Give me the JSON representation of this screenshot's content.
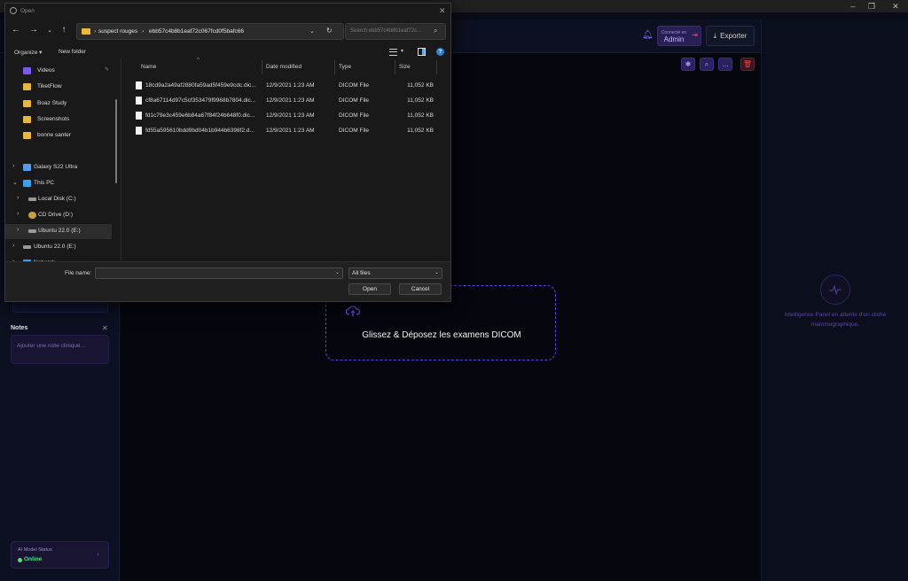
{
  "dialog": {
    "title": "Open",
    "address": {
      "crumbs": [
        "suspect rouges",
        "ebb57c4b8b1eaf72c067fcd0f5bafc66"
      ]
    },
    "search_placeholder": "Search ebb57c4b8b1eaf72c...",
    "toolbar": {
      "organize": "Organize ▾",
      "new_folder": "New folder"
    },
    "sidebar": [
      {
        "label": "Videos",
        "icon": "videos-icon",
        "pinned": true
      },
      {
        "label": "TiketFlow",
        "icon": "folder-icon"
      },
      {
        "label": "Boaz Study",
        "icon": "folder-icon"
      },
      {
        "label": "Screenshots",
        "icon": "folder-icon"
      },
      {
        "label": "bonne santer",
        "icon": "folder-icon"
      },
      {
        "label": "Galaxy S22 Ultra",
        "icon": "phone-icon"
      },
      {
        "label": "This PC",
        "icon": "computer-icon"
      },
      {
        "label": "Local Disk (C:)",
        "icon": "drive-icon"
      },
      {
        "label": "CD Drive (D:)",
        "icon": "cd-drive-icon"
      },
      {
        "label": "Ubuntu 22.0 (E:)",
        "icon": "drive-icon",
        "selected": true
      },
      {
        "label": "Ubuntu 22.0 (E:)",
        "icon": "drive-icon"
      },
      {
        "label": "Network",
        "icon": "network-icon"
      }
    ],
    "columns": {
      "name": "Name",
      "date": "Date modified",
      "type": "Type",
      "size": "Size"
    },
    "files": [
      {
        "name": "18cd9a2a49af2880fa59ad5f459e9cdc.dic...",
        "date": "12/9/2021 1:23 AM",
        "type": "DICOM File",
        "size": "11,052 KB"
      },
      {
        "name": "cf8a67114d97c5cf353479f9968b7804.dic...",
        "date": "12/9/2021 1:23 AM",
        "type": "DICOM File",
        "size": "11,052 KB"
      },
      {
        "name": "fd1c79e3c459e6b84a67f84f24b648f0.dic...",
        "date": "12/9/2021 1:23 AM",
        "type": "DICOM File",
        "size": "11,052 KB"
      },
      {
        "name": "fd55a595610bdd9bd04b1b944b6398f2.d...",
        "date": "12/9/2021 1:23 AM",
        "type": "DICOM File",
        "size": "11,052 KB"
      }
    ],
    "file_name_label": "File name:",
    "file_name_value": "",
    "file_type": "All files",
    "open_label": "Open",
    "cancel_label": "Cancel"
  },
  "app": {
    "header": {
      "role_small": "Connecté en",
      "role_label": "Admin",
      "export_label": "Exporter"
    },
    "dropzone_text": "Glissez & Déposez les examens DICOM",
    "notes": {
      "title": "Notes",
      "placeholder": "Ajouter une note clinique..."
    },
    "ai_status": {
      "label": "AI Model Status",
      "value": "Online"
    },
    "intelligence_text": "Intelligence Panel en attente d'un cliché mammographique."
  },
  "colors": {
    "accent": "#5a3fe0",
    "online": "#4ee08a",
    "danger": "#e04848",
    "folder": "#e8b83a"
  }
}
